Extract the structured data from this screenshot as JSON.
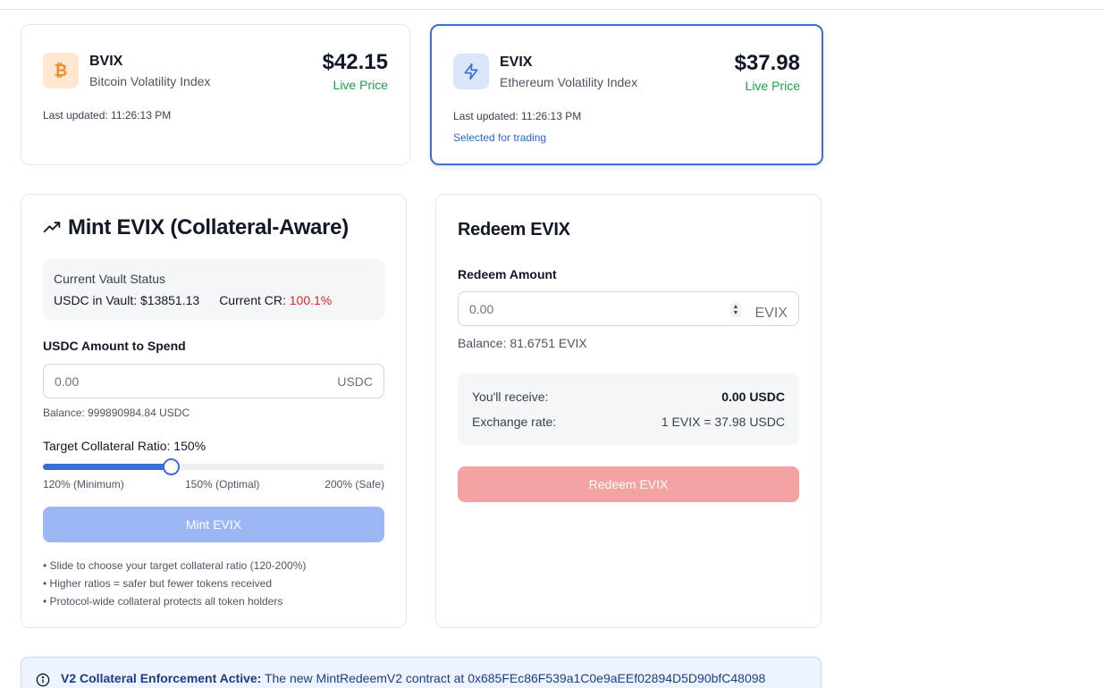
{
  "price_cards": [
    {
      "symbol": "BVIX",
      "name": "Bitcoin Volatility Index",
      "price": "$42.15",
      "live_label": "Live Price",
      "updated": "Last updated: 11:26:13 PM",
      "icon": "bitcoin-icon",
      "icon_glyph": "₿",
      "selected": false
    },
    {
      "symbol": "EVIX",
      "name": "Ethereum Volatility Index",
      "price": "$37.98",
      "live_label": "Live Price",
      "updated": "Last updated: 11:26:13 PM",
      "selected_label": "Selected for trading",
      "icon": "lightning-icon",
      "selected": true
    }
  ],
  "mint": {
    "title": "Mint EVIX (Collateral-Aware)",
    "vault_title": "Current Vault Status",
    "usdc_label": "USDC in Vault:",
    "usdc_value": "$13851.13",
    "cr_label": "Current CR:",
    "cr_value": "100.1%",
    "amount_label": "USDC Amount to Spend",
    "amount_placeholder": "0.00",
    "amount_suffix": "USDC",
    "balance": "Balance: 999890984.84 USDC",
    "target_label": "Target Collateral Ratio: 150%",
    "slider": {
      "min": 120,
      "max": 200,
      "value": 150
    },
    "slider_marks": [
      "120% (Minimum)",
      "150% (Optimal)",
      "200% (Safe)"
    ],
    "button_label": "Mint EVIX",
    "notes": [
      "• Slide to choose your target collateral ratio (120-200%)",
      "• Higher ratios = safer but fewer tokens received",
      "• Protocol-wide collateral protects all token holders"
    ]
  },
  "redeem": {
    "title": "Redeem EVIX",
    "amount_label": "Redeem Amount",
    "amount_placeholder": "0.00",
    "amount_suffix": "EVIX",
    "balance": "Balance: 81.6751 EVIX",
    "receive_label": "You'll receive:",
    "receive_value": "0.00 USDC",
    "rate_label": "Exchange rate:",
    "rate_value": "1 EVIX = 37.98 USDC",
    "button_label": "Redeem EVIX"
  },
  "banner": {
    "bold": "V2 Collateral Enforcement Active:",
    "text": "The new MintRedeemV2 contract at 0x685FEc86F539a1C0e9aEEf02894D5D90bfC48098"
  },
  "colors": {
    "accent": "#3b6fd8",
    "live_green": "#16a34a",
    "cr_red": "#dc2626",
    "mint_button": "#9db7f4",
    "redeem_button": "#f4a3a3"
  }
}
